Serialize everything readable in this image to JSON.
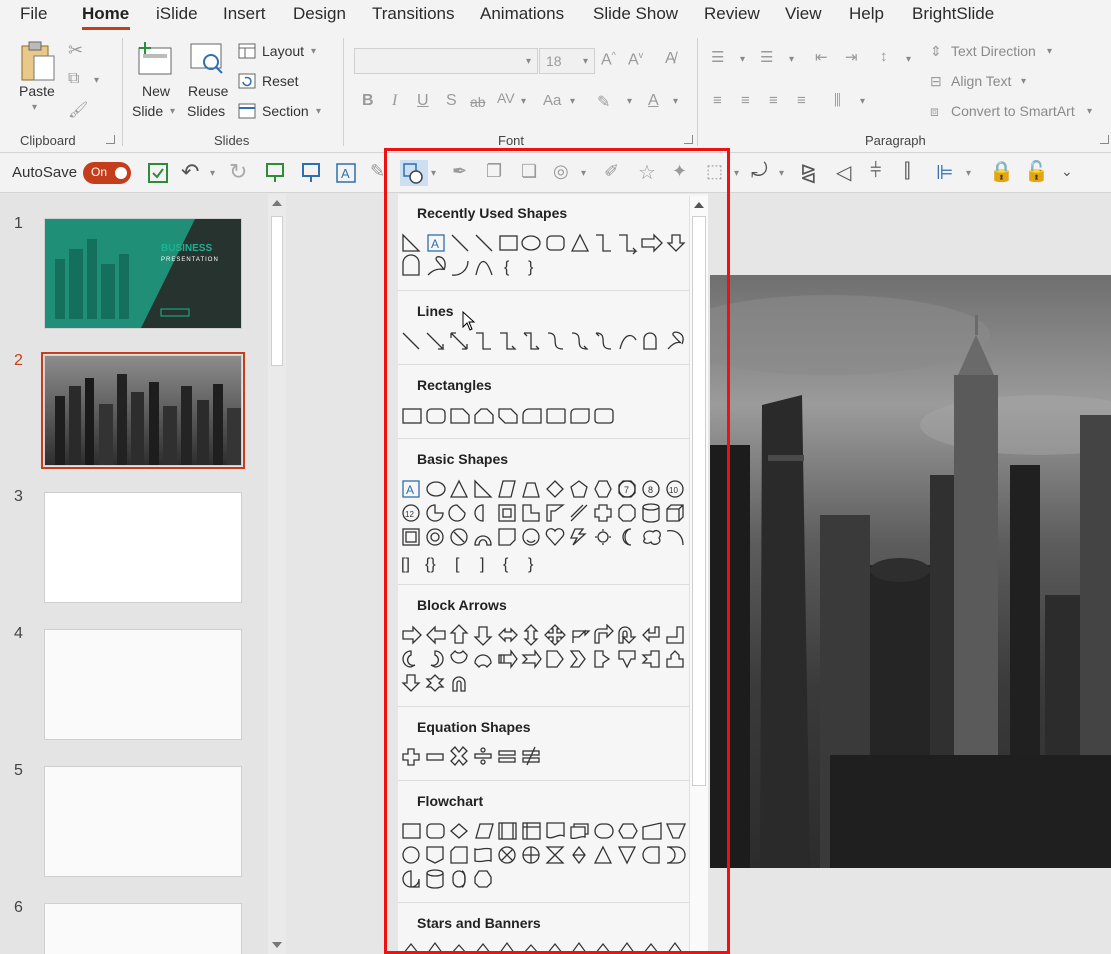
{
  "menu_tabs": [
    "File",
    "Home",
    "iSlide",
    "Insert",
    "Design",
    "Transitions",
    "Animations",
    "Slide Show",
    "Review",
    "View",
    "Help",
    "BrightSlide"
  ],
  "active_tab": "Home",
  "ribbon": {
    "clipboard": {
      "paste": "Paste",
      "group": "Clipboard"
    },
    "slides": {
      "new_slide_1": "New",
      "new_slide_2": "Slide",
      "reuse_1": "Reuse",
      "reuse_2": "Slides",
      "layout": "Layout",
      "reset": "Reset",
      "section": "Section",
      "group": "Slides"
    },
    "font": {
      "font_name": "",
      "font_size": "18",
      "group": "Font"
    },
    "paragraph": {
      "text_direction": "Text Direction",
      "align_text": "Align Text",
      "convert_smartart": "Convert to SmartArt",
      "group": "Paragraph"
    }
  },
  "qat": {
    "autosave_label": "AutoSave",
    "toggle_label": "On"
  },
  "slides": [
    {
      "num": "1",
      "title": "BUSINESS",
      "subtitle": "PRESENTATION"
    },
    {
      "num": "2"
    },
    {
      "num": "3"
    },
    {
      "num": "4"
    },
    {
      "num": "5"
    },
    {
      "num": "6"
    }
  ],
  "shape_menu": {
    "sections": [
      "Recently Used Shapes",
      "Lines",
      "Rectangles",
      "Basic Shapes",
      "Block Arrows",
      "Equation Shapes",
      "Flowchart",
      "Stars and Banners"
    ]
  },
  "colors": {
    "accent": "#c43e1c",
    "highlight_frame": "#ee1111",
    "teal": "#1bb394"
  }
}
